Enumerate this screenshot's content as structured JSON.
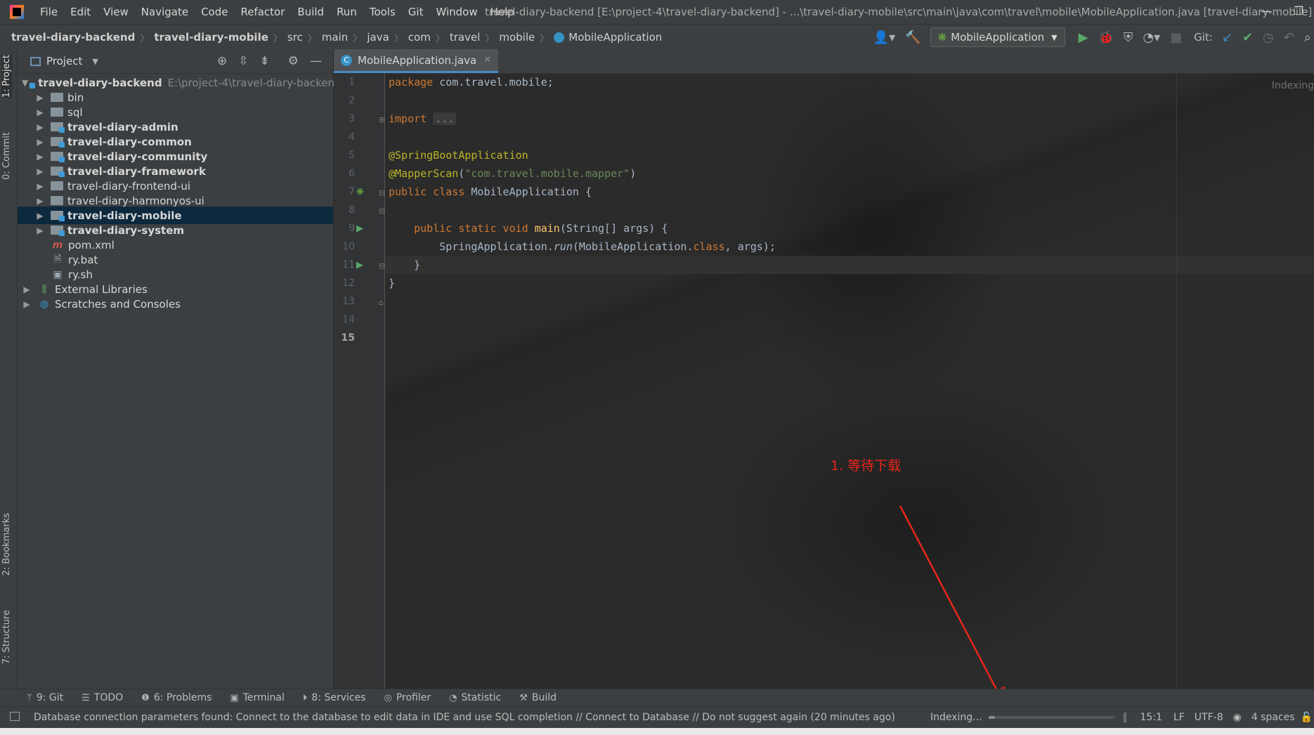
{
  "window_title": "travel-diary-backend [E:\\project-4\\travel-diary-backend] - ...\\travel-diary-mobile\\src\\main\\java\\com\\travel\\mobile\\MobileApplication.java [travel-diary-mobile]",
  "menu": [
    "File",
    "Edit",
    "View",
    "Navigate",
    "Code",
    "Refactor",
    "Build",
    "Run",
    "Tools",
    "Git",
    "Window",
    "Help"
  ],
  "breadcrumbs": [
    "travel-diary-backend",
    "travel-diary-mobile",
    "src",
    "main",
    "java",
    "com",
    "travel",
    "mobile",
    "MobileApplication"
  ],
  "toolbar": {
    "run_config": "MobileApplication",
    "git_label": "Git:"
  },
  "left_strip": {
    "project": "1: Project",
    "commit": "0: Commit",
    "bookmarks": "2: Bookmarks",
    "structure": "7: Structure"
  },
  "project_panel": {
    "title": "Project",
    "root": {
      "name": "travel-diary-backend",
      "path": "E:\\project-4\\travel-diary-backend"
    },
    "items": [
      {
        "label": "bin"
      },
      {
        "label": "sql"
      },
      {
        "label": "travel-diary-admin"
      },
      {
        "label": "travel-diary-common"
      },
      {
        "label": "travel-diary-community"
      },
      {
        "label": "travel-diary-framework"
      },
      {
        "label": "travel-diary-frontend-ui"
      },
      {
        "label": "travel-diary-harmonyos-ui"
      },
      {
        "label": "travel-diary-mobile"
      },
      {
        "label": "travel-diary-system"
      },
      {
        "label": "pom.xml"
      },
      {
        "label": "ry.bat"
      },
      {
        "label": "ry.sh"
      }
    ],
    "external_libraries": "External Libraries",
    "scratches": "Scratches and Consoles"
  },
  "editor": {
    "tab_label": "MobileApplication.java",
    "indexing_hint": "Indexing",
    "line_numbers": [
      "1",
      "2",
      "3",
      "4",
      "5",
      "6",
      "7",
      "8",
      "9",
      "10",
      "11",
      "12",
      "13",
      "14",
      "15"
    ],
    "code": {
      "l1_kw": "package",
      "l1_rest": " com.travel.mobile;",
      "l3_kw": "import",
      "l3_fold": "...",
      "l7": "@SpringBootApplication",
      "l8_ann": "@MapperScan",
      "l8_open": "(",
      "l8_str": "\"com.travel.mobile.mapper\"",
      "l8_close": ")",
      "l9_kw": "public class",
      "l9_rest": " MobileApplication {",
      "l11_indent": "    ",
      "l11_kw": "public static void",
      "l11_sp": " ",
      "l11_fn": "main",
      "l11_rest": "(String[] args) {",
      "l12_a": "        SpringApplication.",
      "l12_run": "run",
      "l12_b": "(MobileApplication.",
      "l12_kw": "class",
      "l12_c": ", args);",
      "l13": "    }",
      "l14": "}"
    }
  },
  "annotation_text": "1. 等待下载",
  "tool_tabs": [
    {
      "label": "9: Git"
    },
    {
      "label": "TODO"
    },
    {
      "label": "6: Problems"
    },
    {
      "label": "Terminal"
    },
    {
      "label": "8: Services"
    },
    {
      "label": "Profiler"
    },
    {
      "label": "Statistic"
    },
    {
      "label": "Build"
    }
  ],
  "status": {
    "message": "Database connection parameters found: Connect to the database to edit data in IDE and use SQL completion // Connect to Database // Do not suggest again (20 minutes ago)",
    "indexing": "Indexing...",
    "indexing_progress": 0.05,
    "position": "15:1",
    "line_sep": "LF",
    "encoding": "UTF-8",
    "indent": "4 spaces"
  },
  "colors": {
    "accent": "#4a88c7",
    "annotation": "#e8261b",
    "selection": "#0d293e"
  }
}
